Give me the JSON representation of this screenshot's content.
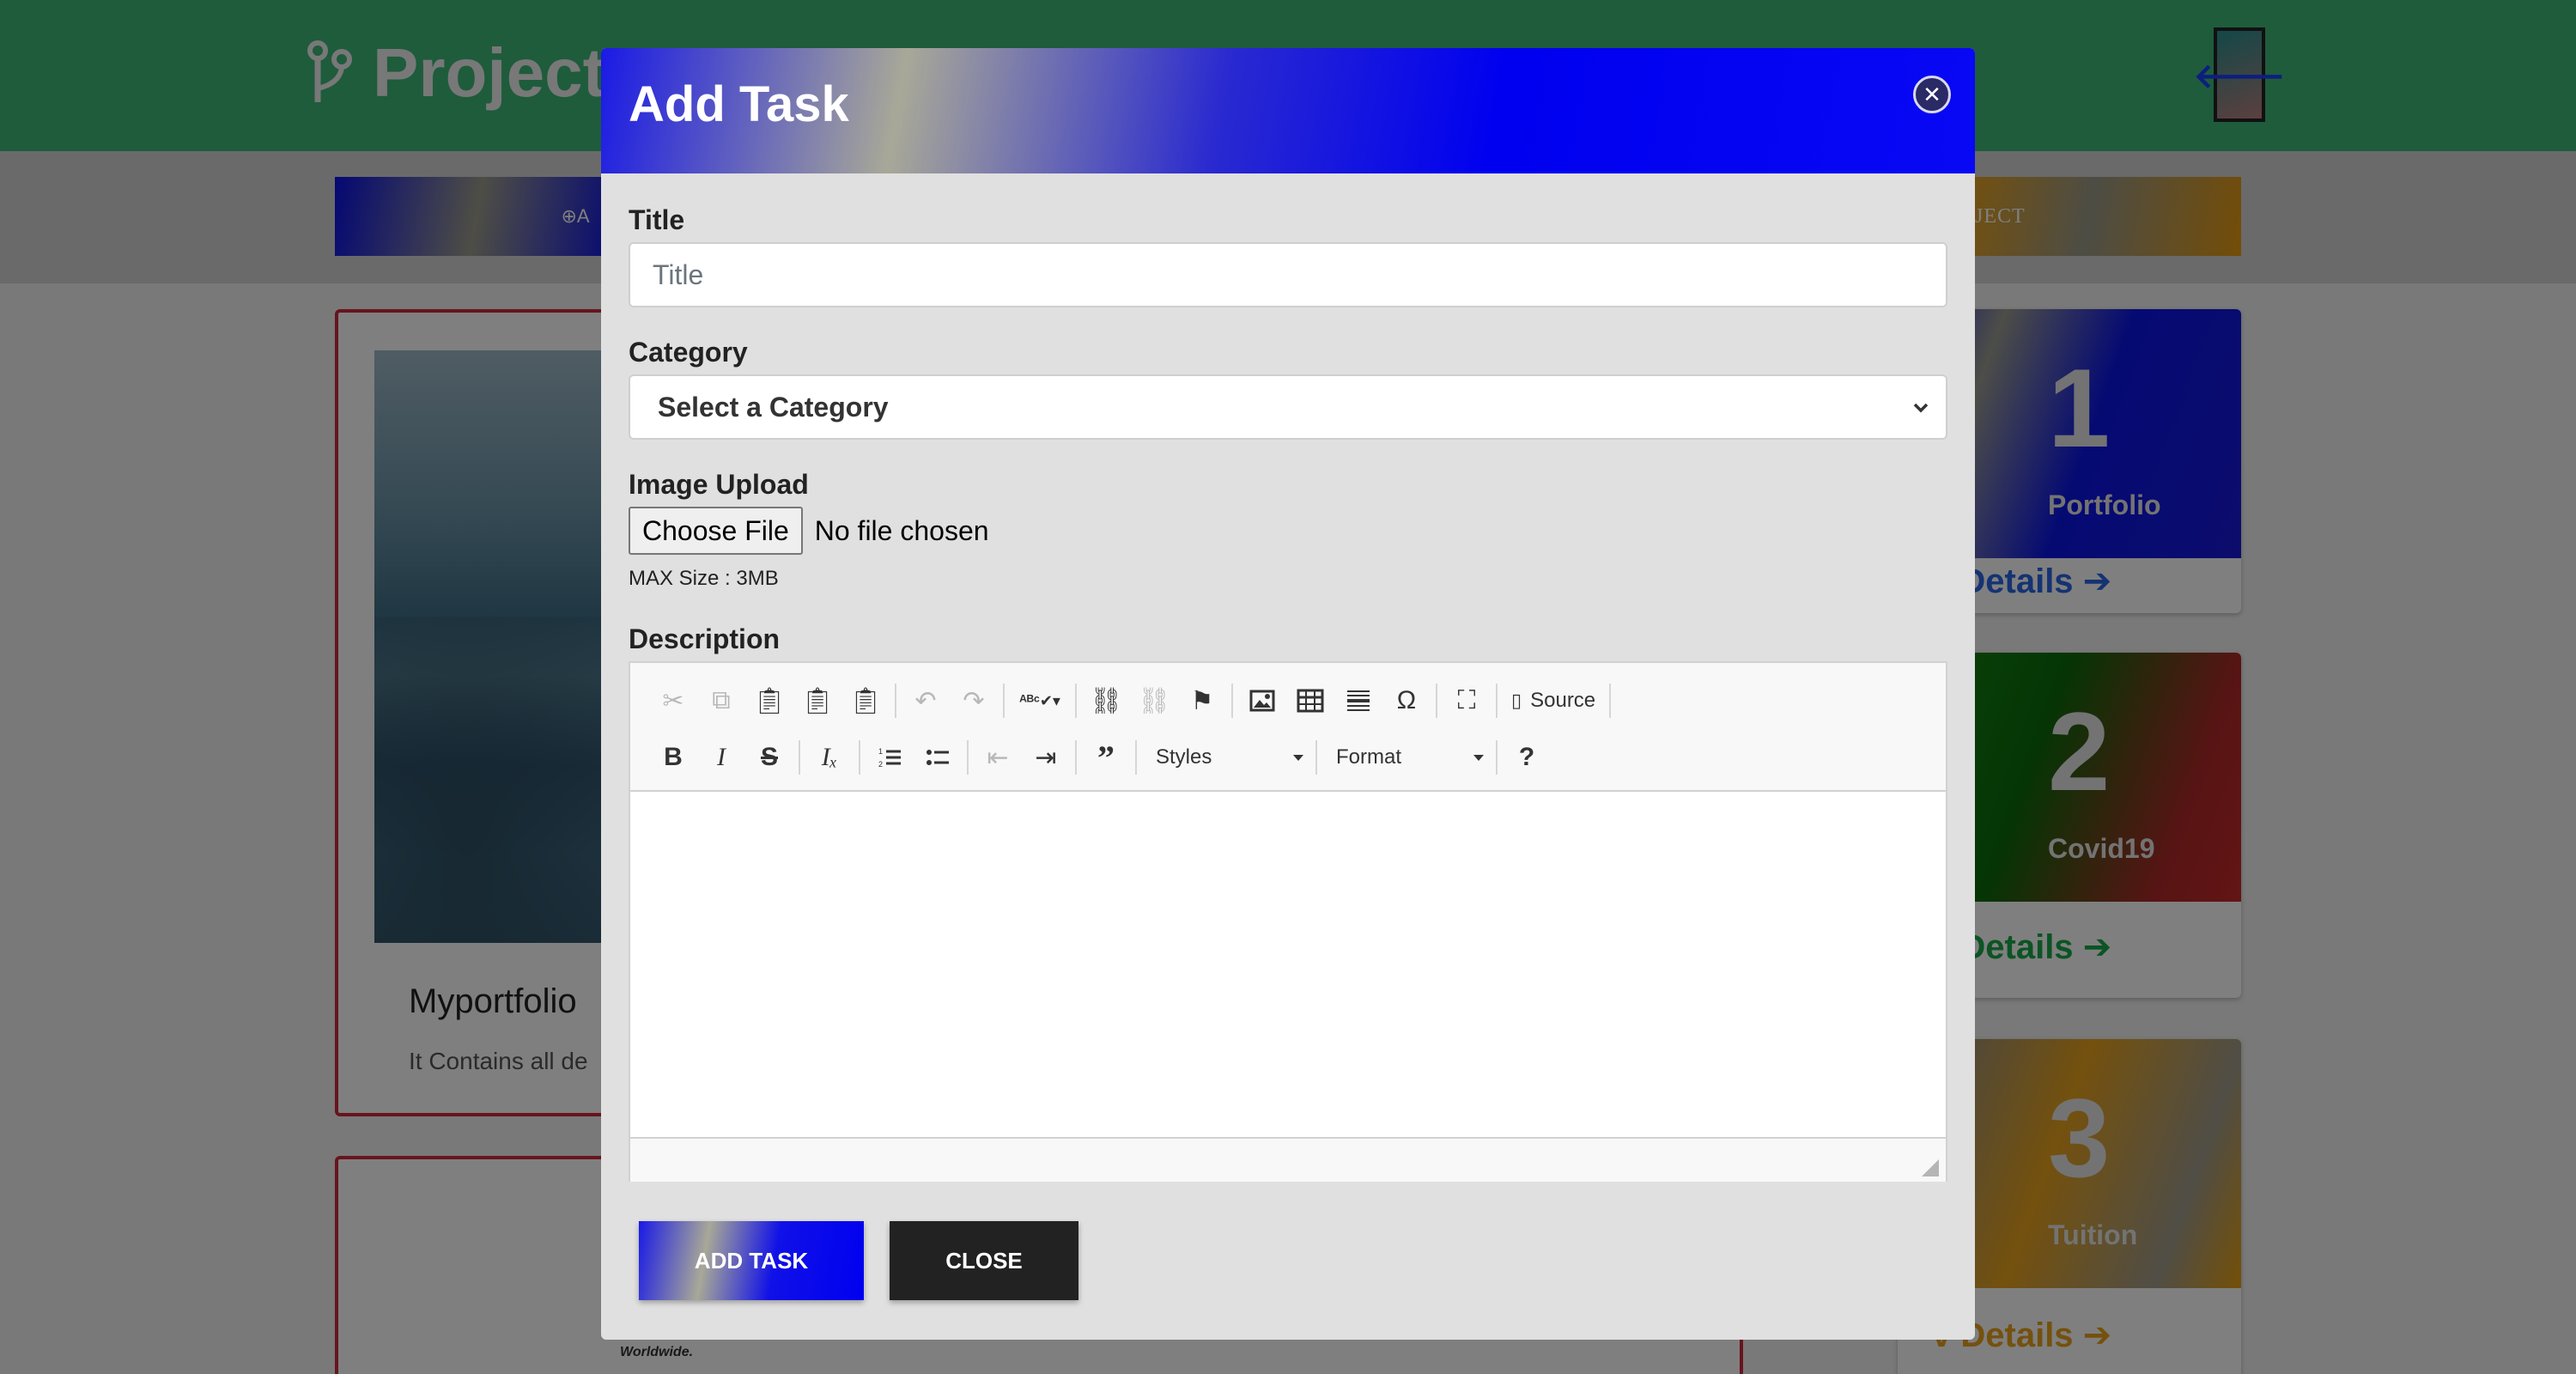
{
  "background": {
    "brand": {
      "text": "Project",
      "icon": "branch-icon"
    },
    "back_button": {
      "icon": "arrow-left-icon",
      "text": "🡐"
    },
    "toolbar_left": {
      "icon": "plus-circle-icon",
      "text": "⊕A"
    },
    "toolbar_right": {
      "text": "JECT"
    },
    "project_card": {
      "title": "Myportfolio",
      "description": "It Contains all de"
    },
    "footer_text": "Worldwide.",
    "stat_cards": [
      {
        "number": "1",
        "label": "Portfolio",
        "link": "Details",
        "link_prefix": "v",
        "color": "#2a66e6"
      },
      {
        "number": "2",
        "label": "Covid19",
        "link": "Details",
        "link_prefix": "v",
        "color": "#18a848"
      },
      {
        "number": "3",
        "label": "Tuition",
        "link": "Details",
        "link_prefix": "v",
        "color": "#e8a21c"
      }
    ]
  },
  "modal": {
    "title": "Add Task",
    "close_icon": "close-circle-icon",
    "form": {
      "title": {
        "label": "Title",
        "placeholder": "Title"
      },
      "category": {
        "label": "Category",
        "selected": "Select a Category"
      },
      "image_upload": {
        "label": "Image Upload",
        "button": "Choose File",
        "status": "No file chosen",
        "hint": "MAX Size : 3MB"
      },
      "description": {
        "label": "Description",
        "toolbar_row1": [
          "cut-icon",
          "copy-icon",
          "paste-icon",
          "paste-text-icon",
          "paste-word-icon",
          "undo-icon",
          "redo-icon",
          "spellcheck-icon",
          "link-icon",
          "unlink-icon",
          "anchor-icon",
          "image-icon",
          "table-icon",
          "horizontal-line-icon",
          "special-char-icon",
          "maximize-icon",
          "source-icon"
        ],
        "source_label": "Source",
        "toolbar_row2": [
          "bold-icon",
          "italic-icon",
          "strikethrough-icon",
          "remove-format-icon",
          "numbered-list-icon",
          "bulleted-list-icon",
          "outdent-icon",
          "indent-icon",
          "blockquote-icon",
          "help-icon"
        ],
        "styles_label": "Styles",
        "format_label": "Format",
        "help_label": "?"
      }
    },
    "buttons": {
      "add": "ADD TASK",
      "close": "CLOSE"
    }
  }
}
